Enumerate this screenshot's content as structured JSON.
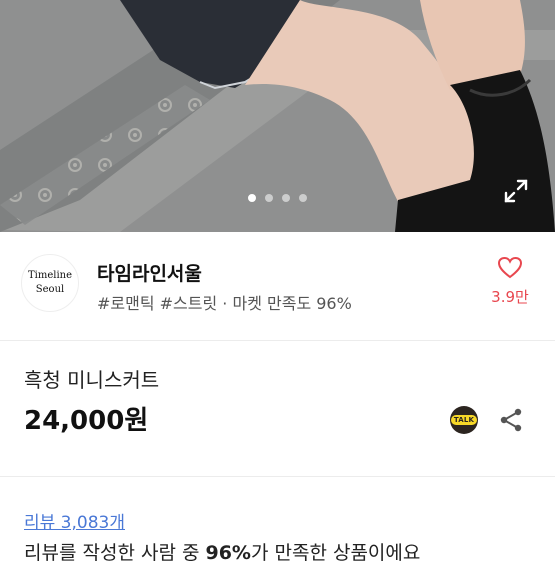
{
  "hero": {
    "image": "photo: denim mini skirt with black boots on stone steps",
    "page_count": 4,
    "active_index": 0,
    "expand_icon": "expand-icon"
  },
  "shop": {
    "logo_line1": "Timeline",
    "logo_line2": "Seoul",
    "name": "타임라인서울",
    "tags": "#로맨틱 #스트릿 · 마켓 만족도 96%",
    "favorite_icon": "heart-outline-icon",
    "favorite_count": "3.9만",
    "accent_color": "#e8474f"
  },
  "product": {
    "name": "흑청 미니스커트",
    "price": "24,000원",
    "talk_label": "TALK",
    "talk_icon": "kakaotalk-icon",
    "share_icon": "share-icon"
  },
  "review": {
    "link": "리뷰 3,083개",
    "summary_prefix": "리뷰를 작성한 사람 중 ",
    "summary_percent": "96%",
    "summary_suffix": "가 만족한 상품이에요"
  }
}
